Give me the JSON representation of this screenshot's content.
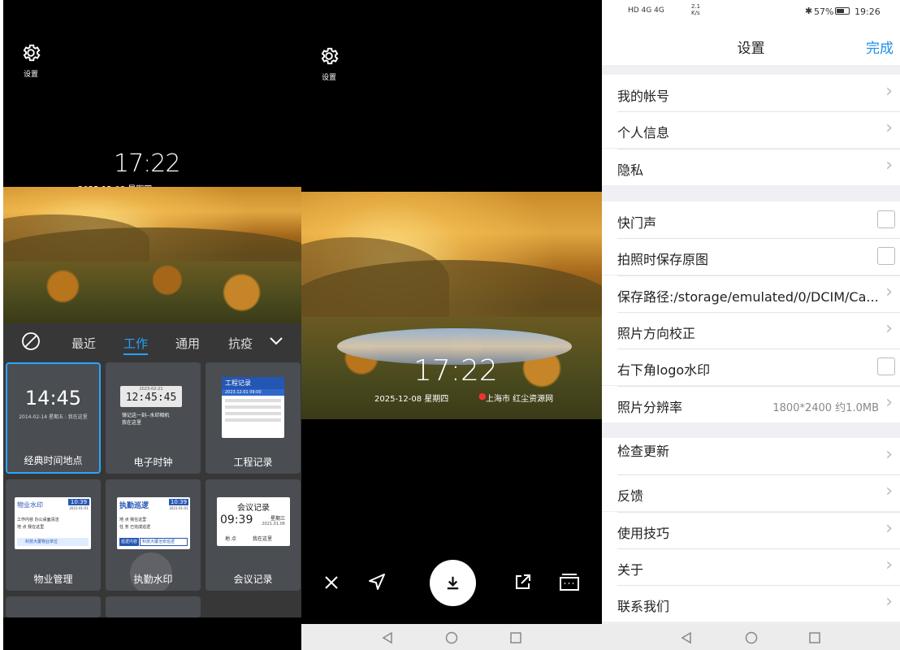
{
  "screen1": {
    "settings_label": "设置",
    "clock_time": "17:22",
    "clock_date": "2025-12-08  星期四",
    "tabs": [
      "最近",
      "工作",
      "通用",
      "抗疫"
    ],
    "active_tab": "工作",
    "templates": [
      {
        "label": "经典时间地点",
        "time": "14:45",
        "sub": "2014-02-14 星期五 : 我在这里"
      },
      {
        "label": "电子时钟",
        "time": "12:45:45",
        "date": "2023-02-21",
        "line1": "镜记这一刻--水印相机",
        "line2": "我在这里"
      },
      {
        "label": "工程记录",
        "title": "工程记录",
        "date": "2023.12.01 09:00"
      },
      {
        "label": "物业管理",
        "title": "物业水印",
        "time": "10:39",
        "date": "2021-01-01",
        "rows": [
          "工作内容  办公桌面清洁",
          "地    点  我在这里"
        ],
        "footer": "科技大厦物业单位"
      },
      {
        "label": "执勤水印",
        "title": "执勤巡逻",
        "time": "10:39",
        "date": "2021-01-01",
        "rows": [
          "地    点  我在这里",
          "任    务  已完成巡逻"
        ],
        "footer1": "巡逻内容",
        "footer2": "科技大厦治安巡逻"
      },
      {
        "label": "会议记录",
        "title": "会议记录",
        "time": "09:39",
        "weekday": "星期三",
        "date": "2021.01.06",
        "place_label": "地    点",
        "place": "我在这里"
      }
    ]
  },
  "screen2": {
    "settings_label": "设置",
    "clock_time": "17:22",
    "clock_date": "2025-12-08  星期四",
    "location": "上海市 红尘资源网"
  },
  "screen3": {
    "status": {
      "left": "HD 4G 4G",
      "speed": "2.1\nK/s",
      "battery": "57%",
      "time": "19:26"
    },
    "title": "设置",
    "done": "完成",
    "group1": [
      {
        "label": "我的帐号",
        "type": "arrow"
      },
      {
        "label": "个人信息",
        "type": "arrow"
      },
      {
        "label": "隐私",
        "type": "arrow"
      }
    ],
    "group2": [
      {
        "label": "快门声",
        "type": "checkbox"
      },
      {
        "label": "拍照时保存原图",
        "type": "checkbox"
      },
      {
        "label": "保存路径:/storage/emulated/0/DCIM/Ca...",
        "type": "arrow"
      },
      {
        "label": "照片方向校正",
        "type": "arrow"
      },
      {
        "label": "右下角logo水印",
        "type": "checkbox"
      },
      {
        "label": "照片分辨率",
        "value": "1800*2400 约1.0MB",
        "type": "arrow"
      }
    ],
    "group3": [
      {
        "label": "检查更新",
        "type": "arrow"
      },
      {
        "label": "反馈",
        "type": "arrow"
      },
      {
        "label": "使用技巧",
        "type": "arrow"
      },
      {
        "label": "关于",
        "type": "arrow"
      },
      {
        "label": "联系我们",
        "type": "arrow"
      }
    ]
  },
  "colors": {
    "accent": "#22a3ff",
    "done": "#1e8ee8"
  }
}
